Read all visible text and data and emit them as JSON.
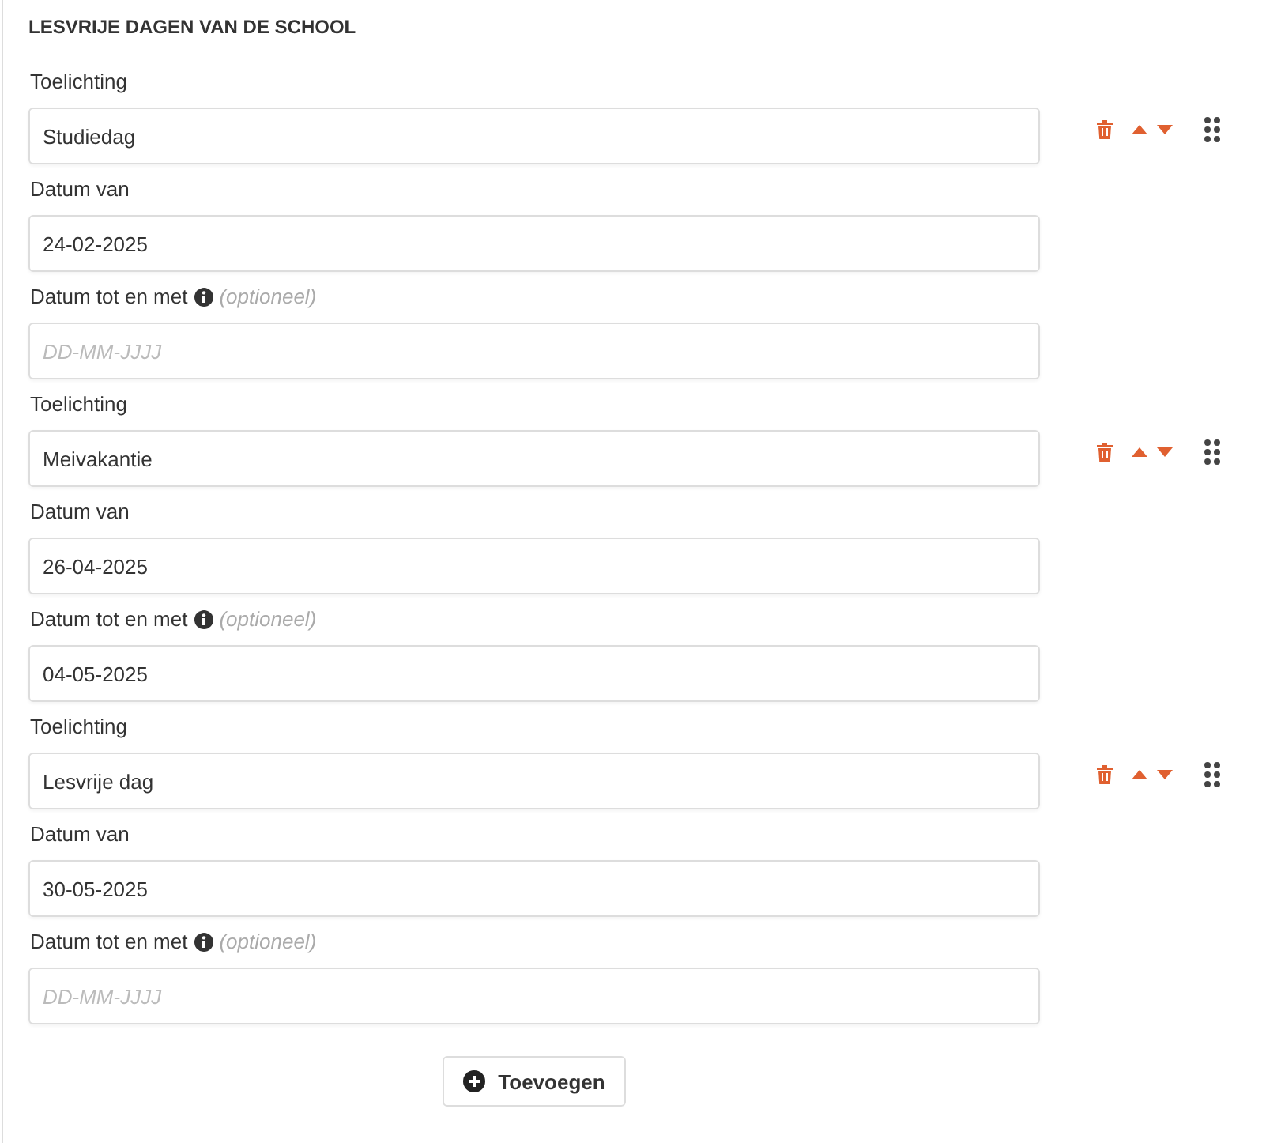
{
  "section_title": "LESVRIJE DAGEN VAN DE SCHOOL",
  "entries": [
    {
      "fields": [
        {
          "label": "Toelichting",
          "value": "Studiedag"
        },
        {
          "label": "Datum van",
          "value": "24-02-2025"
        },
        {
          "label": "Datum tot en met",
          "note": "(optioneel)",
          "placeholder": "DD-MM-JJJJ"
        }
      ]
    },
    {
      "fields": [
        {
          "label": "Toelichting",
          "value": "Meivakantie"
        },
        {
          "label": "Datum van",
          "value": "26-04-2025"
        },
        {
          "label": "Datum tot en met",
          "note": "(optioneel)",
          "value": "04-05-2025"
        }
      ]
    },
    {
      "fields": [
        {
          "label": "Toelichting",
          "value": "Lesvrije dag"
        },
        {
          "label": "Datum van",
          "value": "30-05-2025"
        },
        {
          "label": "Datum tot en met",
          "note": "(optioneel)",
          "placeholder": "DD-MM-JJJJ"
        }
      ]
    }
  ],
  "add_button": "Toevoegen"
}
